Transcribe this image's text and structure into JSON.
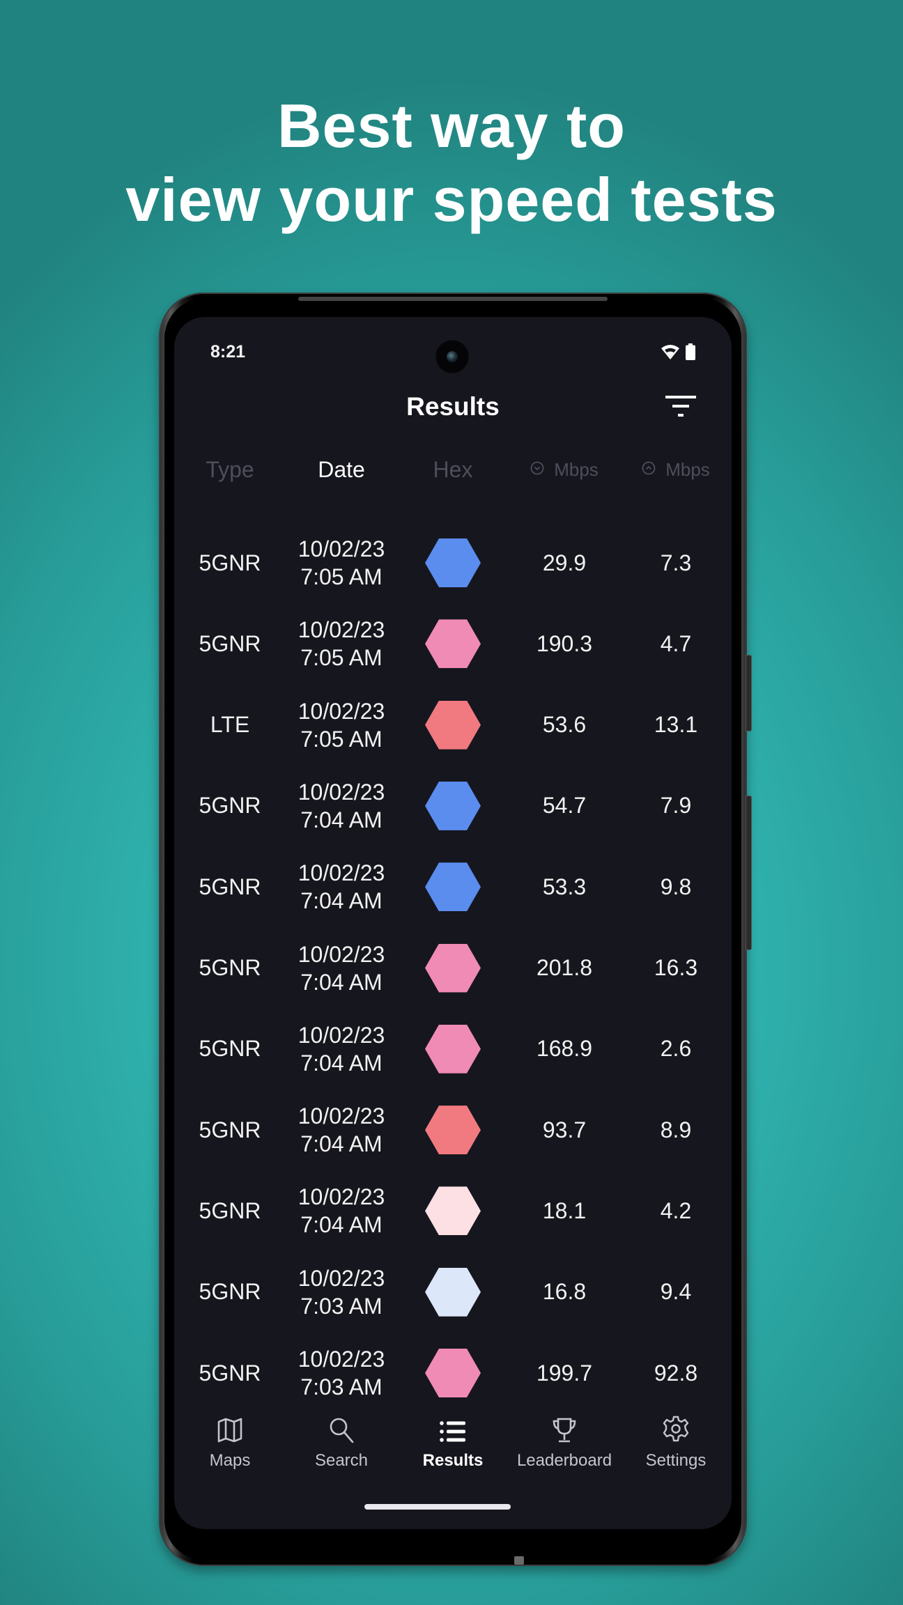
{
  "headline": {
    "line1": "Best way to",
    "line2": "view your speed tests"
  },
  "status_bar": {
    "time": "8:21",
    "icons": [
      "wifi-icon",
      "battery-icon"
    ]
  },
  "header": {
    "title": "Results",
    "filter_icon": "filter-icon"
  },
  "columns": [
    {
      "label": "Type",
      "active": false
    },
    {
      "label": "Date",
      "active": true
    },
    {
      "label": "Hex",
      "active": false
    },
    {
      "label": "Mbps",
      "icon": "download-circle-icon",
      "active": false
    },
    {
      "label": "Mbps",
      "icon": "upload-circle-icon",
      "active": false
    }
  ],
  "hex_colors": {
    "blue": "#5b8def",
    "pink": "#f08bb5",
    "red": "#f07a80",
    "light_pink": "#fde0e4",
    "light_blue": "#dde7fa"
  },
  "results": [
    {
      "type": "5GNR",
      "date": "10/02/23",
      "time": "7:05 AM",
      "hex": "#5b8def",
      "download": "29.9",
      "upload": "7.3"
    },
    {
      "type": "5GNR",
      "date": "10/02/23",
      "time": "7:05 AM",
      "hex": "#f08bb5",
      "download": "190.3",
      "upload": "4.7"
    },
    {
      "type": "LTE",
      "date": "10/02/23",
      "time": "7:05 AM",
      "hex": "#f07a80",
      "download": "53.6",
      "upload": "13.1"
    },
    {
      "type": "5GNR",
      "date": "10/02/23",
      "time": "7:04 AM",
      "hex": "#5b8def",
      "download": "54.7",
      "upload": "7.9"
    },
    {
      "type": "5GNR",
      "date": "10/02/23",
      "time": "7:04 AM",
      "hex": "#5b8def",
      "download": "53.3",
      "upload": "9.8"
    },
    {
      "type": "5GNR",
      "date": "10/02/23",
      "time": "7:04 AM",
      "hex": "#f08bb5",
      "download": "201.8",
      "upload": "16.3"
    },
    {
      "type": "5GNR",
      "date": "10/02/23",
      "time": "7:04 AM",
      "hex": "#f08bb5",
      "download": "168.9",
      "upload": "2.6"
    },
    {
      "type": "5GNR",
      "date": "10/02/23",
      "time": "7:04 AM",
      "hex": "#f07a80",
      "download": "93.7",
      "upload": "8.9"
    },
    {
      "type": "5GNR",
      "date": "10/02/23",
      "time": "7:04 AM",
      "hex": "#fde0e4",
      "download": "18.1",
      "upload": "4.2"
    },
    {
      "type": "5GNR",
      "date": "10/02/23",
      "time": "7:03 AM",
      "hex": "#dde7fa",
      "download": "16.8",
      "upload": "9.4"
    },
    {
      "type": "5GNR",
      "date": "10/02/23",
      "time": "7:03 AM",
      "hex": "#f08bb5",
      "download": "199.7",
      "upload": "92.8"
    }
  ],
  "bottom_nav": [
    {
      "label": "Maps",
      "icon": "map-icon",
      "active": false
    },
    {
      "label": "Search",
      "icon": "search-icon",
      "active": false
    },
    {
      "label": "Results",
      "icon": "list-icon",
      "active": true
    },
    {
      "label": "Leaderboard",
      "icon": "trophy-icon",
      "active": false
    },
    {
      "label": "Settings",
      "icon": "gear-icon",
      "active": false
    }
  ]
}
